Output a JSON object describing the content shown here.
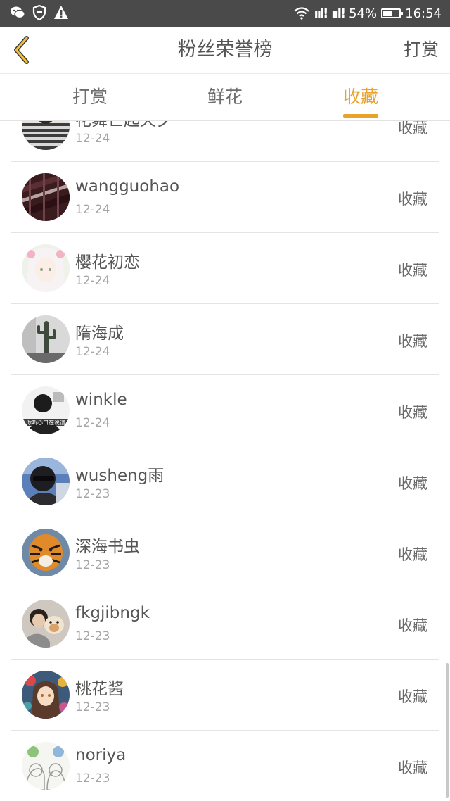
{
  "status_bar": {
    "signal_1": "ııl!",
    "signal_2": "ııl!",
    "battery_percent": "54%",
    "battery_level": 0.54,
    "time": "16:54",
    "icons": [
      "wechat-icon",
      "shield-icon",
      "warning-icon",
      "wifi-icon",
      "battery-icon"
    ]
  },
  "nav": {
    "title": "粉丝荣誉榜",
    "right_label": "打赏",
    "back_icon": "chevron-left-icon",
    "accent_color": "#e9a22a"
  },
  "tabs": [
    {
      "label": "打赏",
      "active": false
    },
    {
      "label": "鲜花",
      "active": false
    },
    {
      "label": "收藏",
      "active": true
    }
  ],
  "list": [
    {
      "name": "花舞亡起火夕",
      "date": "12-24",
      "action": "收藏",
      "avatar": "avatar-striped-shirt"
    },
    {
      "name": "wangguohao",
      "date": "12-24",
      "action": "收藏",
      "avatar": "avatar-dark-red-abstract"
    },
    {
      "name": "樱花初恋",
      "date": "12-24",
      "action": "收藏",
      "avatar": "avatar-anime-girl-pink"
    },
    {
      "name": "隋海成",
      "date": "12-24",
      "action": "收藏",
      "avatar": "avatar-cactus"
    },
    {
      "name": "winkle",
      "date": "12-24",
      "action": "收藏",
      "avatar": "avatar-bw-portrait",
      "avatar_caption": "你听心口在说谎"
    },
    {
      "name": "wusheng雨",
      "date": "12-23",
      "action": "收藏",
      "avatar": "avatar-sunglasses-blue"
    },
    {
      "name": "深海书虫",
      "date": "12-23",
      "action": "收藏",
      "avatar": "avatar-tiger"
    },
    {
      "name": "fkgjibngk",
      "date": "12-23",
      "action": "收藏",
      "avatar": "avatar-person-with-dog"
    },
    {
      "name": "桃花酱",
      "date": "12-23",
      "action": "收藏",
      "avatar": "avatar-anime-colorful"
    },
    {
      "name": "noriya",
      "date": "12-23",
      "action": "收藏",
      "avatar": "avatar-sketch-twins"
    }
  ]
}
